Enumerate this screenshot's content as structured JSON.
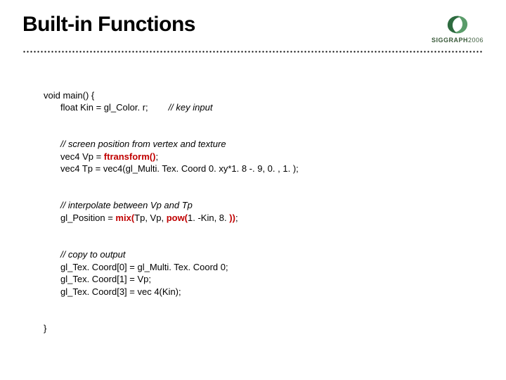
{
  "title": "Built-in Functions",
  "logo": {
    "text_bold": "SIGGRAPH",
    "text_year": "2006"
  },
  "code": {
    "l1": "void main() {",
    "l2a": "float Kin = gl_Color. r;",
    "l2b": "// key input",
    "l3": "// screen position from vertex and texture",
    "l4a": "vec4 Vp = ",
    "l4b": "ftransform()",
    "l4c": ";",
    "l5": "vec4 Tp = vec4(gl_Multi. Tex. Coord 0. xy*1. 8 -. 9, 0. , 1. );",
    "l6": "// interpolate between Vp and Tp",
    "l7a": "gl_Position = ",
    "l7b": "mix(",
    "l7c": "Tp, Vp, ",
    "l7d": "pow(",
    "l7e": "1. -Kin, 8. ",
    "l7f": "))",
    "l7g": ";",
    "l8": "// copy to output",
    "l9": "gl_Tex. Coord[0] = gl_Multi. Tex. Coord 0;",
    "l10": "gl_Tex. Coord[1] = Vp;",
    "l11": "gl_Tex. Coord[3] = vec 4(Kin);",
    "l12": "}"
  }
}
